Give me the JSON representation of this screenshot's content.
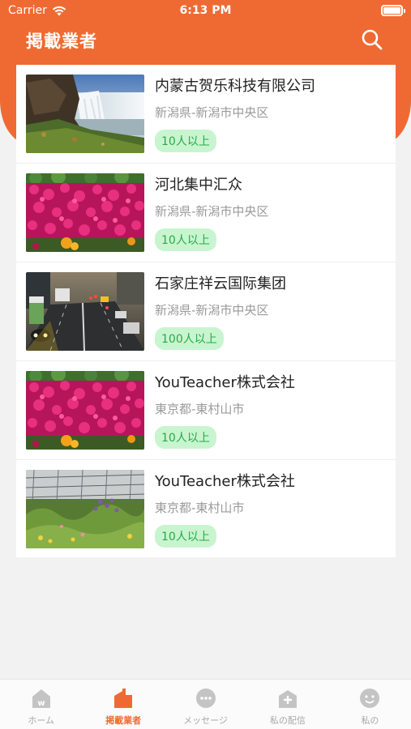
{
  "status_bar": {
    "carrier": "Carrier",
    "time": "6:13 PM"
  },
  "header": {
    "title": "掲載業者",
    "search_icon": "search-icon"
  },
  "companies": [
    {
      "name": "内蒙古贺乐科技有限公司",
      "location": "新潟県-新潟市中央区",
      "size_badge": "10人以上",
      "image": "waterfall"
    },
    {
      "name": "河北集中汇众",
      "location": "新潟県-新潟市中央区",
      "size_badge": "10人以上",
      "image": "pink-flowers"
    },
    {
      "name": "石家庄祥云国际集团",
      "location": "新潟県-新潟市中央区",
      "size_badge": "100人以上",
      "image": "city-traffic"
    },
    {
      "name": "YouTeacher株式会社",
      "location": "東京都-東村山市",
      "size_badge": "10人以上",
      "image": "pink-flowers"
    },
    {
      "name": "YouTeacher株式会社",
      "location": "東京都-東村山市",
      "size_badge": "10人以上",
      "image": "wildflowers"
    }
  ],
  "tabbar": {
    "tabs": [
      {
        "label": "ホーム",
        "icon": "home-icon",
        "active": false
      },
      {
        "label": "掲載業者",
        "icon": "company-icon",
        "active": true
      },
      {
        "label": "メッセージ",
        "icon": "message-icon",
        "active": false
      },
      {
        "label": "私の配信",
        "icon": "distribution-icon",
        "active": false
      },
      {
        "label": "私の",
        "icon": "profile-icon",
        "active": false
      }
    ]
  },
  "colors": {
    "accent": "#ef6a32",
    "badge_bg": "#c8f5cf",
    "badge_text": "#29a94a",
    "inactive_tab": "#a8a8a8"
  }
}
